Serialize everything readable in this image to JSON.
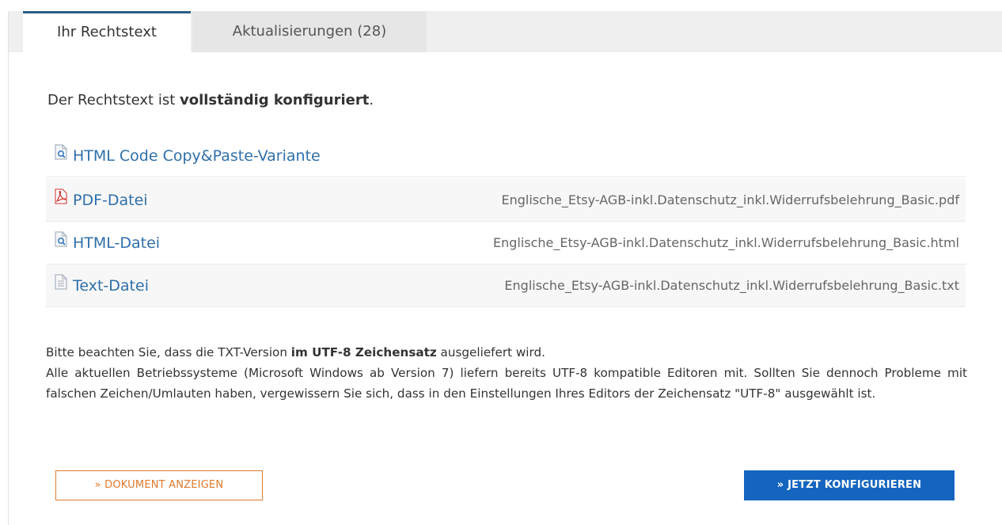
{
  "tabs": {
    "active_label": "Ihr Rechtstext",
    "updates_label": "Aktualisierungen (28)"
  },
  "intro": {
    "prefix": "Der Rechtstext ist ",
    "bold": "vollständig konfiguriert",
    "suffix": "."
  },
  "files": [
    {
      "label": "HTML Code Copy&Paste-Variante",
      "icon": "html-doc-icon",
      "filename": ""
    },
    {
      "label": "PDF-Datei",
      "icon": "pdf-icon",
      "filename": "Englische_Etsy-AGB-inkl.Datenschutz_inkl.Widerrufsbelehrung_Basic.pdf"
    },
    {
      "label": "HTML-Datei",
      "icon": "html-doc-icon",
      "filename": "Englische_Etsy-AGB-inkl.Datenschutz_inkl.Widerrufsbelehrung_Basic.html"
    },
    {
      "label": "Text-Datei",
      "icon": "text-doc-icon",
      "filename": "Englische_Etsy-AGB-inkl.Datenschutz_inkl.Widerrufsbelehrung_Basic.txt"
    }
  ],
  "note": {
    "line1_prefix": "Bitte beachten Sie, dass die TXT-Version ",
    "line1_bold": "im UTF-8 Zeichensatz",
    "line1_suffix": " ausgeliefert wird.",
    "paragraph": "Alle aktuellen Betriebssysteme (Microsoft Windows ab Version 7) liefern bereits UTF-8 kompatible Editoren mit. Sollten Sie dennoch Probleme mit falschen Zeichen/Umlauten haben, vergewissern Sie sich, dass in den Einstellungen Ihres Editors der Zeichensatz \"UTF-8\" ausgewählt ist."
  },
  "buttons": {
    "show_document": "» DOKUMENT ANZEIGEN",
    "configure": "» JETZT KONFIGURIEREN"
  },
  "colors": {
    "link": "#2f6faa",
    "primary": "#1565c0",
    "outline": "#e07a2e",
    "tab_accent": "#2d5d86"
  }
}
